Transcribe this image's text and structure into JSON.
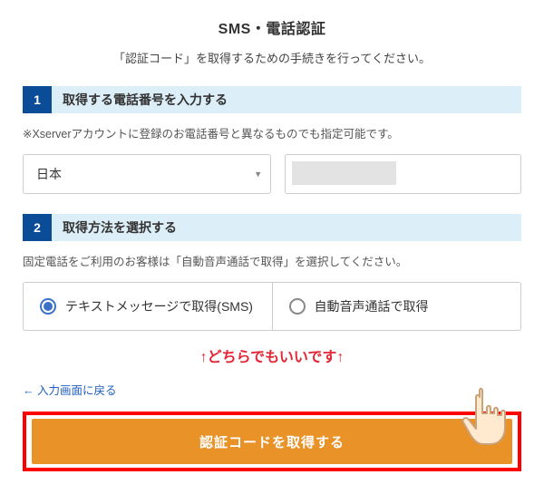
{
  "header": {
    "title": "SMS・電話認証",
    "subtitle": "「認証コード」を取得するための手続きを行ってください。"
  },
  "step1": {
    "number": "1",
    "title": "取得する電話番号を入力する",
    "note": "※Xserverアカウントに登録のお電話番号と異なるものでも指定可能です。",
    "country": "日本",
    "phone_value": ""
  },
  "step2": {
    "number": "2",
    "title": "取得方法を選択する",
    "note": "固定電話をご利用のお客様は「自動音声通話で取得」を選択してください。",
    "option_sms": "テキストメッセージで取得(SMS)",
    "option_voice": "自動音声通話で取得"
  },
  "annotation": "↑どちらでもいいです↑",
  "back_link": "← 入力画面に戻る",
  "submit_label": "認証コードを取得する"
}
